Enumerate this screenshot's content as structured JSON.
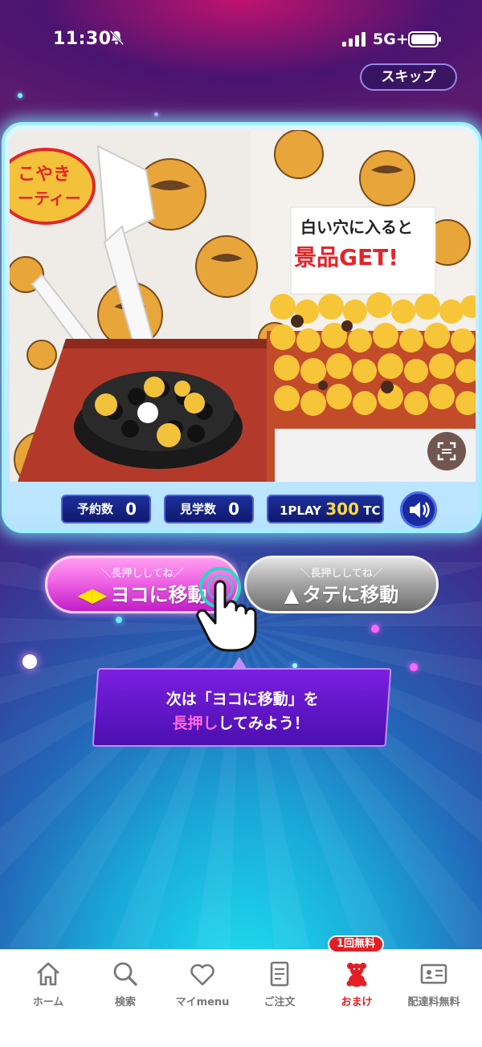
{
  "status_bar": {
    "time": "11:30",
    "network": "5G+",
    "icons": [
      "bell-slash-icon",
      "signal-icon",
      "battery-icon"
    ]
  },
  "header": {
    "skip_label": "スキップ"
  },
  "video": {
    "sign_line1": "白い穴に入ると",
    "sign_line2": "景品GET!",
    "banner_line1": "こやき",
    "banner_line2": "ーティー"
  },
  "stats": {
    "reserve_label": "予約数",
    "reserve_value": "0",
    "watch_label": "見学数",
    "watch_value": "0",
    "play_prefix": "1PLAY",
    "play_price": "300",
    "play_unit": "TC"
  },
  "controls": {
    "yoko_hint": "＼長押ししてね／",
    "yoko_label": "ヨコに移動",
    "tate_hint": "＼長押ししてね／",
    "tate_label": "タテに移動"
  },
  "tooltip": {
    "line1": "次は「ヨコに移動」を",
    "line2_highlight": "長押し",
    "line2_rest": "してみよう！"
  },
  "tabbar": {
    "items": [
      {
        "label": "ホーム",
        "icon": "home-icon"
      },
      {
        "label": "検索",
        "icon": "search-icon"
      },
      {
        "label": "マイmenu",
        "icon": "heart-icon"
      },
      {
        "label": "ご注文",
        "icon": "document-icon"
      },
      {
        "label": "おまけ",
        "icon": "bear-icon"
      },
      {
        "label": "配達料無料",
        "icon": "id-card-icon"
      }
    ],
    "badge": "1回無料",
    "active_color": "#e31e24"
  }
}
